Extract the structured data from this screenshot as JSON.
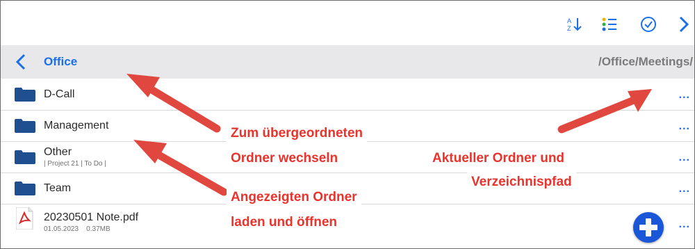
{
  "toolbar": {
    "buttons": [
      {
        "name": "sort-az-icon"
      },
      {
        "name": "list-icon"
      },
      {
        "name": "select-check-icon"
      },
      {
        "name": "forward-chevron-icon"
      }
    ]
  },
  "pathbar": {
    "back_icon": "chevron-left-icon",
    "current_folder": "Office",
    "path": "/Office/Meetings/"
  },
  "rows": [
    {
      "title": "D-Call",
      "subtitle": "",
      "type": "folder",
      "more": "..."
    },
    {
      "title": "Management",
      "subtitle": "",
      "type": "folder",
      "more": "..."
    },
    {
      "title": "Other",
      "subtitle": "| Project 21 | To Do |",
      "type": "folder",
      "more": "..."
    },
    {
      "title": "Team",
      "subtitle": "",
      "type": "folder",
      "more": "..."
    },
    {
      "title": "20230501 Note.pdf",
      "subtitle": "01.05.2023    0.37MB",
      "type": "pdf",
      "more": "..."
    }
  ],
  "callouts": {
    "parent_line1": "Zum übergeordneten",
    "parent_line2": "Ordner wechseln",
    "open_line1": "Angezeigten Ordner",
    "open_line2": "laden und öffnen",
    "current_line1": "Aktueller Ordner und",
    "current_line2": "Verzeichnispfad"
  },
  "colors": {
    "accent": "#1a6fe8",
    "folder": "#1f4f8f",
    "callout": "#e8342c",
    "arrow": "#e0483f",
    "pathbar_bg": "#e8e8ea"
  }
}
